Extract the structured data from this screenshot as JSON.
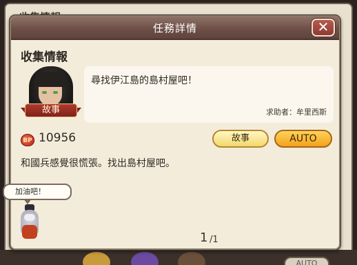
{
  "background": {
    "title": "收集情報",
    "auto_label": "AUTO"
  },
  "dialog": {
    "title": "任務詳情",
    "close_label": "✕",
    "section_title": "收集情報",
    "portrait_ribbon": "故事",
    "quest_text": "尋找伊江島的島村屋吧！",
    "requester": "求助者：牟里西斯",
    "bp_icon": "BP",
    "bp_value": "10956",
    "story_button": "故事",
    "auto_button": "AUTO",
    "description": "和國兵感覺很慌張。找出島村屋吧。",
    "page_current": "1",
    "page_total": "/1"
  },
  "mascot": {
    "speech": "加油吧！"
  },
  "colors": {
    "header": "#6e5048",
    "dialog_bg": "#f3ecdb",
    "auto_button": "#f3a21c",
    "story_button": "#f2d96c",
    "close_button": "#8e3b33"
  }
}
